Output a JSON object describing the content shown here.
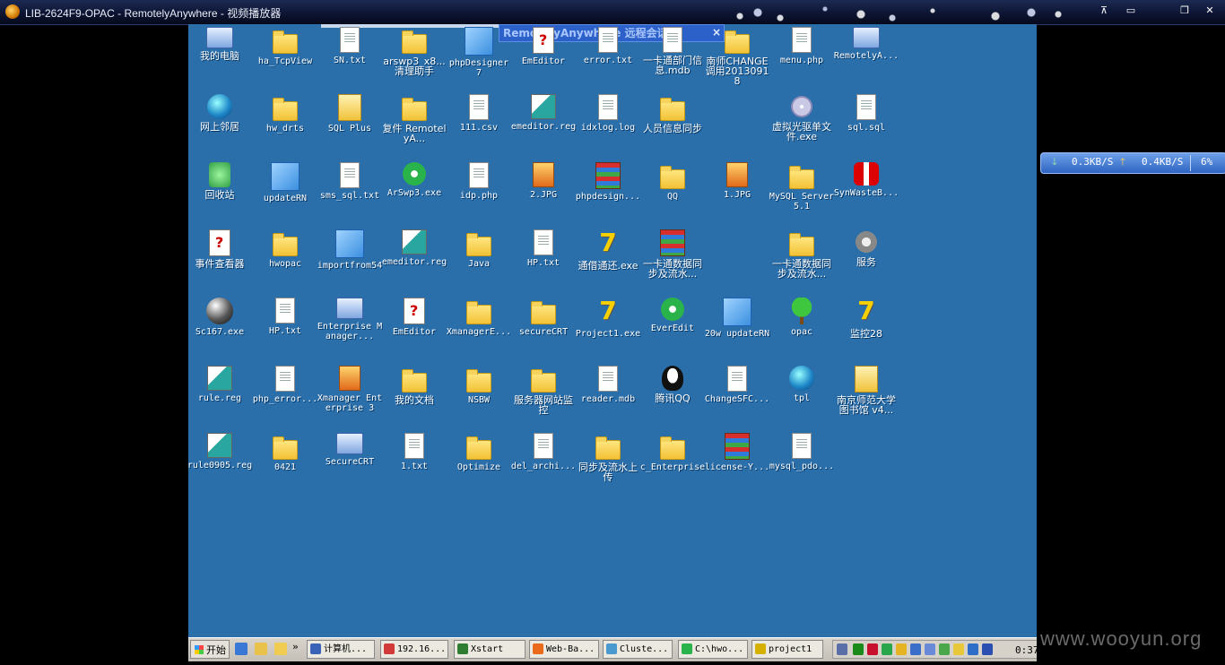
{
  "window": {
    "title": "LIB-2624F9-OPAC - RemotelyAnywhere - 视频播放器",
    "controls": [
      "minimize-to-tray",
      "restore",
      "maximize",
      "close"
    ]
  },
  "remote_bar": {
    "label": "RemotelyAnywhere  远程会话",
    "close": "×"
  },
  "desktop_icons": [
    {
      "label": "我的电脑",
      "icon": "my-computer-icon"
    },
    {
      "label": "ha_TcpView",
      "icon": "folder-icon"
    },
    {
      "label": "SN.txt",
      "icon": "text-file-icon"
    },
    {
      "label": "arswp3_x8...清理助手",
      "icon": "folder-icon"
    },
    {
      "label": "phpDesigner 7",
      "icon": "phpdesigner-icon"
    },
    {
      "label": "EmEditor",
      "icon": "emeditor-icon"
    },
    {
      "label": "error.txt",
      "icon": "text-file-icon"
    },
    {
      "label": "一卡通部门信息.mdb",
      "icon": "mdb-file-icon"
    },
    {
      "label": "南师CHANGE调用20130918",
      "icon": "folder-icon"
    },
    {
      "label": "menu.php",
      "icon": "php-file-icon"
    },
    {
      "label": "RemotelyA...",
      "icon": "remotelyanywhere-icon"
    },
    {
      "label": "网上邻居",
      "icon": "network-places-icon"
    },
    {
      "label": "hw_drts",
      "icon": "folder-icon"
    },
    {
      "label": "SQL Plus",
      "icon": "sqlplus-icon"
    },
    {
      "label": "复件 RemotelyA...",
      "icon": "folder-icon"
    },
    {
      "label": "111.csv",
      "icon": "text-file-icon"
    },
    {
      "label": "emeditor.reg",
      "icon": "registry-file-icon"
    },
    {
      "label": "idxlog.log",
      "icon": "text-file-icon"
    },
    {
      "label": "人员信息同步",
      "icon": "folder-icon"
    },
    {
      "label": "虚拟光驱单文件.exe",
      "icon": "virtual-cd-icon"
    },
    {
      "label": "sql.sql",
      "icon": "text-file-icon"
    },
    {
      "label": "回收站",
      "icon": "recycle-bin-icon"
    },
    {
      "label": "updateRN",
      "icon": "application-icon"
    },
    {
      "label": "sms_sql.txt",
      "icon": "text-file-icon"
    },
    {
      "label": "ArSwp3.exe",
      "icon": "arswp-icon"
    },
    {
      "label": "idp.php",
      "icon": "php-file-icon"
    },
    {
      "label": "2.JPG",
      "icon": "image-file-icon"
    },
    {
      "label": "phpdesign...",
      "icon": "winrar-icon"
    },
    {
      "label": "QQ",
      "icon": "folder-icon"
    },
    {
      "label": "1.JPG",
      "icon": "image-file-icon"
    },
    {
      "label": "MySQL Server 5.1",
      "icon": "folder-icon"
    },
    {
      "label": "SynWasteB...",
      "icon": "gift-icon"
    },
    {
      "label": "事件查看器",
      "icon": "event-viewer-icon"
    },
    {
      "label": "hwopac",
      "icon": "folder-icon"
    },
    {
      "label": "importfrom54",
      "icon": "application-icon"
    },
    {
      "label": "emeditor.reg",
      "icon": "registry-file-icon"
    },
    {
      "label": "Java",
      "icon": "folder-icon"
    },
    {
      "label": "HP.txt",
      "icon": "text-file-icon"
    },
    {
      "label": "通借通还.exe",
      "icon": "delphi-app-icon"
    },
    {
      "label": "一卡通数据同步及流水...",
      "icon": "winrar-icon"
    },
    {
      "label": "一卡通数据同步及流水...",
      "icon": "folder-icon"
    },
    {
      "label": "服务",
      "icon": "services-icon"
    },
    {
      "label": "Sc167.exe",
      "icon": "sphere-icon"
    },
    {
      "label": "HP.txt",
      "icon": "text-file-icon"
    },
    {
      "label": "Enterprise Manager...",
      "icon": "enterprise-manager-icon"
    },
    {
      "label": "EmEditor",
      "icon": "emeditor-icon"
    },
    {
      "label": "XmanagerE...",
      "icon": "folder-icon"
    },
    {
      "label": "secureCRT",
      "icon": "folder-icon"
    },
    {
      "label": "Project1.exe",
      "icon": "delphi-app-icon"
    },
    {
      "label": "EverEdit",
      "icon": "everedit-icon"
    },
    {
      "label": "20w updateRN",
      "icon": "application-icon"
    },
    {
      "label": "opac",
      "icon": "tree-icon"
    },
    {
      "label": "监控28",
      "icon": "delphi-app-icon"
    },
    {
      "label": "rule.reg",
      "icon": "registry-file-icon"
    },
    {
      "label": "php_error...",
      "icon": "text-file-icon"
    },
    {
      "label": "Xmanager Enterprise 3",
      "icon": "xmanager-icon"
    },
    {
      "label": "我的文档",
      "icon": "my-documents-icon"
    },
    {
      "label": "NSBW",
      "icon": "folder-icon"
    },
    {
      "label": "服务器网站监控",
      "icon": "folder-icon"
    },
    {
      "label": "reader.mdb",
      "icon": "mdb-file-icon"
    },
    {
      "label": "腾讯QQ",
      "icon": "qq-icon"
    },
    {
      "label": "ChangeSFC...",
      "icon": "changesfc-icon"
    },
    {
      "label": "tpl",
      "icon": "paint-icon"
    },
    {
      "label": "南京师范大学图书馆 v4...",
      "icon": "library-app-icon"
    },
    {
      "label": "rule0905.reg",
      "icon": "registry-file-icon"
    },
    {
      "label": "0421",
      "icon": "folder-icon"
    },
    {
      "label": "SecureCRT",
      "icon": "securecrt-icon"
    },
    {
      "label": "1.txt",
      "icon": "text-file-icon"
    },
    {
      "label": "Optimize",
      "icon": "folder-icon"
    },
    {
      "label": "del_archi...",
      "icon": "text-file-icon"
    },
    {
      "label": "同步及流水上传",
      "icon": "folder-icon"
    },
    {
      "label": "c_Enterprise",
      "icon": "folder-icon"
    },
    {
      "label": "license-Y...",
      "icon": "winrar-icon"
    },
    {
      "label": "mysql_pdo...",
      "icon": "text-file-icon"
    }
  ],
  "taskbar": {
    "start_label": "开始",
    "tasks": [
      {
        "label": "计算机..."
      },
      {
        "label": "192.16..."
      },
      {
        "label": "Xstart"
      },
      {
        "label": "Web-Ba..."
      },
      {
        "label": "Cluste..."
      },
      {
        "label": "C:\\hwo..."
      },
      {
        "label": "project1"
      }
    ],
    "clock": "0:37"
  },
  "speed_widget": {
    "down_speed": "0.3KB/S",
    "up_speed": "0.4KB/S",
    "cpu_percent": "6%"
  },
  "watermark": "www.wooyun.org",
  "colors": {
    "desktop_background": "#2a6eaa",
    "title_bar": "#0d1533",
    "taskbar": "#d4d0c8"
  }
}
